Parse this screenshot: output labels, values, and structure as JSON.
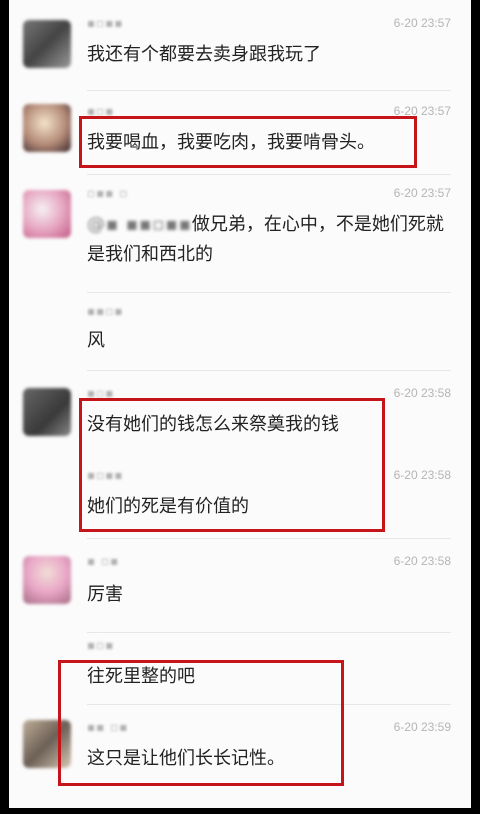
{
  "messages": [
    {
      "sender": "",
      "time": "6-20 23:57",
      "text": "我还有个都要去卖身跟我玩了"
    },
    {
      "sender": "",
      "time": "6-20 23:57",
      "text": "我要喝血，我要吃肉，我要啃骨头。"
    },
    {
      "sender": "",
      "time": "6-20 23:57",
      "mention": "@",
      "text": "做兄弟，在心中，不是她们死就是我们和西北的"
    },
    {
      "sender": "",
      "time": "",
      "text": "风"
    },
    {
      "sender": "",
      "time": "6-20 23:58",
      "text": "没有她们的钱怎么来祭奠我的钱"
    },
    {
      "sender": "",
      "time": "6-20 23:58",
      "text": "她们的死是有价值的"
    },
    {
      "sender": "",
      "time": "6-20 23:58",
      "text": "厉害"
    },
    {
      "sender": "",
      "time": "",
      "text": "往死里整的吧"
    },
    {
      "sender": "",
      "time": "6-20 23:59",
      "text": "这只是让他们长长记性。"
    }
  ],
  "colors": {
    "highlight_box": "#c5151a",
    "background": "#fbfbfb",
    "timestamp": "#b5b5b5"
  }
}
